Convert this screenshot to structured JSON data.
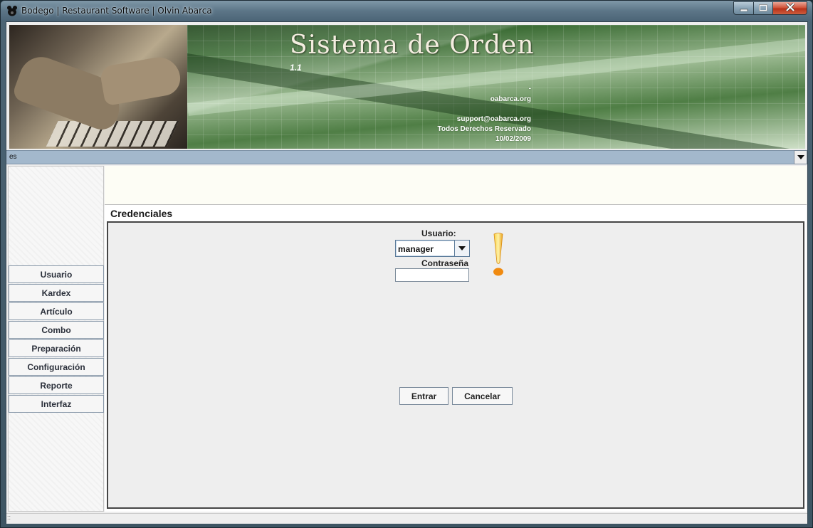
{
  "window": {
    "title": "Bodego | Restaurant Software | Olvin Abarca",
    "icons": {
      "app": "bear-icon",
      "minimize": "minimize-icon",
      "maximize": "maximize-icon",
      "close": "close-icon"
    }
  },
  "banner": {
    "title": "Sistema de Orden",
    "version": "1.1",
    "dash": "-",
    "site": "oabarca.org",
    "support": "support@oabarca.org",
    "rights": "Todos Derechos Reservado",
    "date": "10/02/2009"
  },
  "language": {
    "selected": "es",
    "icon": "chevron-down-icon"
  },
  "sidebar": {
    "items": [
      {
        "label": "Usuario"
      },
      {
        "label": "Kardex"
      },
      {
        "label": "Artículo"
      },
      {
        "label": "Combo"
      },
      {
        "label": "Preparación"
      },
      {
        "label": "Configuración"
      },
      {
        "label": "Reporte"
      },
      {
        "label": "Interfaz"
      }
    ]
  },
  "credentials": {
    "title": "Credenciales",
    "user_label": "Usuario:",
    "user_value": "manager",
    "password_label": "Contraseña",
    "password_value": "",
    "warning_icon": "exclamation-icon",
    "enter_label": "Entrar",
    "cancel_label": "Cancelar"
  },
  "colors": {
    "lang_bar": "#a3b8cc",
    "warning": "#f0a020",
    "message_strip": "#fdfdf5"
  },
  "status": {
    "grip": "::"
  }
}
